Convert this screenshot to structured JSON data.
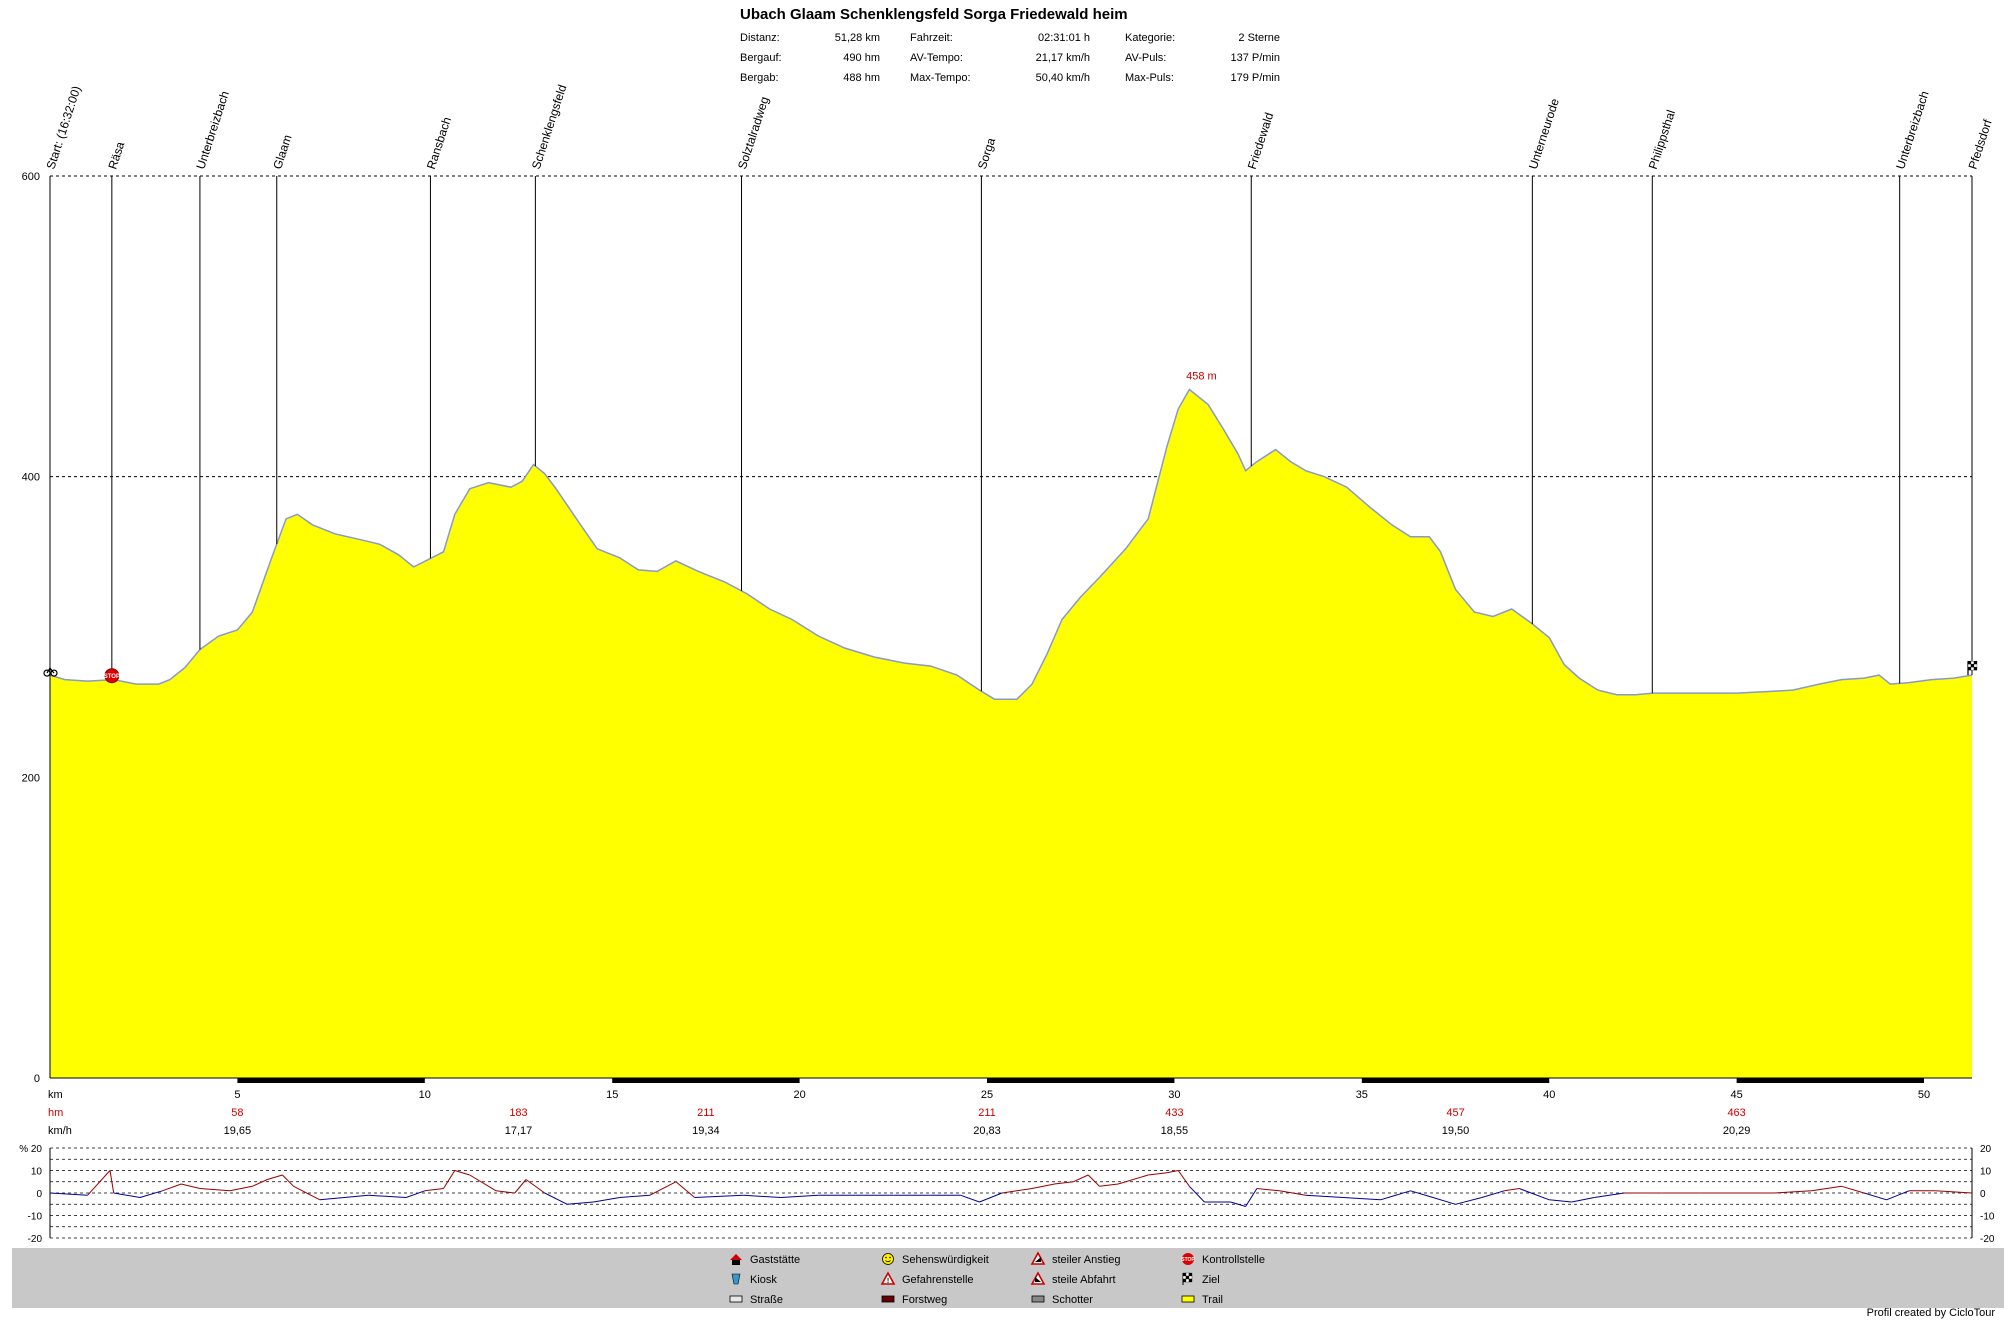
{
  "title": "Ubach Glaam Schenklengsfeld Sorga Friedewald heim",
  "stats": {
    "col1": [
      {
        "label": "Distanz:",
        "value": "51,28 km"
      },
      {
        "label": "Bergauf:",
        "value": "490 hm"
      },
      {
        "label": "Bergab:",
        "value": "488 hm"
      }
    ],
    "col2": [
      {
        "label": "Fahrzeit:",
        "value": "02:31:01 h"
      },
      {
        "label": "AV-Tempo:",
        "value": "21,17 km/h"
      },
      {
        "label": "Max-Tempo:",
        "value": "50,40 km/h"
      }
    ],
    "col3": [
      {
        "label": "Kategorie:",
        "value": "2 Sterne"
      },
      {
        "label": "AV-Puls:",
        "value": "137 P/min"
      },
      {
        "label": "Max-Puls:",
        "value": "179 P/min"
      }
    ]
  },
  "colors": {
    "fill": "#ffff00",
    "profile_line": "#8899cc",
    "grade_up": "#990000",
    "grade_down": "#000099",
    "accent_red": "#cc0000",
    "legend_bg": "#c8c8c8"
  },
  "chart_data": [
    {
      "type": "area",
      "x_unit": "km",
      "y_unit": "m",
      "xlim": [
        0,
        51.28
      ],
      "ylim": [
        0,
        600
      ],
      "y_ticks": [
        0,
        200,
        400,
        600
      ],
      "x_ticks": [
        5,
        10,
        15,
        20,
        25,
        30,
        35,
        40,
        45,
        50
      ],
      "grid": "horizontal dashed",
      "x_axis_label": "km",
      "max_label": "458 m",
      "max_point": {
        "x": 30.4,
        "y": 458
      },
      "waypoints": [
        {
          "name": "Start: (16:32:00)",
          "km": 0.0
        },
        {
          "name": "Räsa",
          "km": 1.65
        },
        {
          "name": "Unterbreizbach",
          "km": 4.0
        },
        {
          "name": "Glaam",
          "km": 6.05
        },
        {
          "name": "Ransbach",
          "km": 10.15
        },
        {
          "name": "Schenklengsfeld",
          "km": 12.95
        },
        {
          "name": "Solztalradweg",
          "km": 18.45
        },
        {
          "name": "Sorga",
          "km": 24.85
        },
        {
          "name": "Friedewald",
          "km": 32.05
        },
        {
          "name": "Unterneurode",
          "km": 39.55
        },
        {
          "name": "Philippsthal",
          "km": 42.75
        },
        {
          "name": "Unterbreizbach",
          "km": 49.35
        },
        {
          "name": "Pfedsdorf",
          "km": 51.28
        }
      ],
      "series": [
        {
          "points": [
            [
              0.0,
              268
            ],
            [
              0.4,
              265
            ],
            [
              1.0,
              264
            ],
            [
              1.7,
              265
            ],
            [
              2.3,
              262
            ],
            [
              2.9,
              262
            ],
            [
              3.2,
              265
            ],
            [
              3.6,
              273
            ],
            [
              4.0,
              285
            ],
            [
              4.5,
              294
            ],
            [
              5.0,
              298
            ],
            [
              5.4,
              310
            ],
            [
              5.9,
              345
            ],
            [
              6.3,
              372
            ],
            [
              6.6,
              375
            ],
            [
              7.0,
              368
            ],
            [
              7.6,
              362
            ],
            [
              8.3,
              358
            ],
            [
              8.8,
              355
            ],
            [
              9.3,
              348
            ],
            [
              9.7,
              340
            ],
            [
              10.1,
              345
            ],
            [
              10.5,
              350
            ],
            [
              10.8,
              375
            ],
            [
              11.2,
              392
            ],
            [
              11.7,
              396
            ],
            [
              12.3,
              393
            ],
            [
              12.6,
              397
            ],
            [
              12.9,
              408
            ],
            [
              13.2,
              402
            ],
            [
              13.5,
              392
            ],
            [
              14.1,
              370
            ],
            [
              14.6,
              352
            ],
            [
              15.2,
              346
            ],
            [
              15.7,
              338
            ],
            [
              16.2,
              337
            ],
            [
              16.7,
              344
            ],
            [
              17.3,
              337
            ],
            [
              18.0,
              330
            ],
            [
              18.6,
              322
            ],
            [
              19.2,
              312
            ],
            [
              19.8,
              305
            ],
            [
              20.5,
              294
            ],
            [
              21.2,
              286
            ],
            [
              22.0,
              280
            ],
            [
              22.8,
              276
            ],
            [
              23.5,
              274
            ],
            [
              24.2,
              268
            ],
            [
              24.8,
              258
            ],
            [
              25.2,
              252
            ],
            [
              25.8,
              252
            ],
            [
              26.2,
              262
            ],
            [
              26.6,
              282
            ],
            [
              27.0,
              305
            ],
            [
              27.5,
              320
            ],
            [
              28.0,
              333
            ],
            [
              28.7,
              352
            ],
            [
              29.3,
              372
            ],
            [
              29.8,
              420
            ],
            [
              30.1,
              445
            ],
            [
              30.4,
              458
            ],
            [
              30.9,
              448
            ],
            [
              31.3,
              432
            ],
            [
              31.7,
              415
            ],
            [
              31.9,
              404
            ],
            [
              32.2,
              410
            ],
            [
              32.7,
              418
            ],
            [
              33.1,
              410
            ],
            [
              33.5,
              404
            ],
            [
              34.0,
              400
            ],
            [
              34.6,
              393
            ],
            [
              35.2,
              380
            ],
            [
              35.8,
              368
            ],
            [
              36.3,
              360
            ],
            [
              36.8,
              360
            ],
            [
              37.1,
              350
            ],
            [
              37.5,
              325
            ],
            [
              38.0,
              310
            ],
            [
              38.5,
              307
            ],
            [
              39.0,
              312
            ],
            [
              39.5,
              303
            ],
            [
              40.0,
              293
            ],
            [
              40.4,
              275
            ],
            [
              40.8,
              266
            ],
            [
              41.3,
              258
            ],
            [
              41.8,
              255
            ],
            [
              42.3,
              255
            ],
            [
              42.8,
              256
            ],
            [
              43.5,
              256
            ],
            [
              44.2,
              256
            ],
            [
              45.0,
              256
            ],
            [
              45.8,
              257
            ],
            [
              46.5,
              258
            ],
            [
              47.2,
              262
            ],
            [
              47.8,
              265
            ],
            [
              48.4,
              266
            ],
            [
              48.8,
              268
            ],
            [
              49.1,
              262
            ],
            [
              49.6,
              263
            ],
            [
              50.2,
              265
            ],
            [
              50.8,
              266
            ],
            [
              51.28,
              268
            ]
          ]
        }
      ],
      "markers": [
        {
          "kind": "start",
          "km": 0.0,
          "label": "Start"
        },
        {
          "kind": "stop",
          "km": 1.65,
          "label": "STOP"
        },
        {
          "kind": "finish",
          "km": 51.28,
          "label": "Ziel"
        }
      ]
    },
    {
      "type": "table",
      "rows": [
        {
          "label": "hm",
          "values": [
            "58",
            "183",
            "211",
            "211",
            "433",
            "457",
            "463"
          ]
        },
        {
          "label": "km/h",
          "values": [
            "19,65",
            "17,17",
            "19,34",
            "20,83",
            "18,55",
            "19,50",
            "20,29"
          ]
        }
      ],
      "at_km": [
        5,
        12.5,
        17.5,
        25,
        30,
        37.5,
        45
      ]
    },
    {
      "type": "line",
      "y_unit": "%",
      "ylim": [
        -20,
        20
      ],
      "y_ticks": [
        -20,
        -10,
        0,
        10,
        20
      ],
      "axis_label": "%",
      "grid": "horizontal dashed",
      "series": [
        {
          "points": [
            [
              0.0,
              0
            ],
            [
              1.0,
              -1
            ],
            [
              1.6,
              10
            ],
            [
              1.7,
              0
            ],
            [
              2.4,
              -2
            ],
            [
              3.0,
              1
            ],
            [
              3.5,
              4
            ],
            [
              4.0,
              2
            ],
            [
              4.8,
              1
            ],
            [
              5.4,
              3
            ],
            [
              5.8,
              6
            ],
            [
              6.2,
              8
            ],
            [
              6.5,
              3
            ],
            [
              7.2,
              -3
            ],
            [
              8.5,
              -1
            ],
            [
              9.5,
              -2
            ],
            [
              10.0,
              1
            ],
            [
              10.5,
              2
            ],
            [
              10.8,
              10
            ],
            [
              11.2,
              8
            ],
            [
              11.9,
              1
            ],
            [
              12.4,
              0
            ],
            [
              12.7,
              6
            ],
            [
              13.2,
              0
            ],
            [
              13.8,
              -5
            ],
            [
              14.5,
              -4
            ],
            [
              15.2,
              -2
            ],
            [
              16.0,
              -1
            ],
            [
              16.7,
              5
            ],
            [
              17.2,
              -2
            ],
            [
              18.5,
              -1
            ],
            [
              19.5,
              -2
            ],
            [
              20.5,
              -1
            ],
            [
              21.5,
              -1
            ],
            [
              22.5,
              -1
            ],
            [
              23.5,
              -1
            ],
            [
              24.3,
              -1
            ],
            [
              24.8,
              -4
            ],
            [
              25.4,
              0
            ],
            [
              26.2,
              2
            ],
            [
              26.8,
              4
            ],
            [
              27.3,
              5
            ],
            [
              27.7,
              8
            ],
            [
              28.0,
              3
            ],
            [
              28.5,
              4
            ],
            [
              29.3,
              8
            ],
            [
              29.8,
              9
            ],
            [
              30.1,
              10
            ],
            [
              30.4,
              3
            ],
            [
              30.8,
              -4
            ],
            [
              31.5,
              -4
            ],
            [
              31.9,
              -6
            ],
            [
              32.2,
              2
            ],
            [
              32.8,
              1
            ],
            [
              33.5,
              -1
            ],
            [
              34.5,
              -2
            ],
            [
              35.5,
              -3
            ],
            [
              36.3,
              1
            ],
            [
              36.9,
              -2
            ],
            [
              37.5,
              -5
            ],
            [
              38.2,
              -2
            ],
            [
              38.8,
              1
            ],
            [
              39.2,
              2
            ],
            [
              40.0,
              -3
            ],
            [
              40.6,
              -4
            ],
            [
              41.2,
              -2
            ],
            [
              42.0,
              0
            ],
            [
              43.0,
              0
            ],
            [
              44.0,
              0
            ],
            [
              45.0,
              0
            ],
            [
              46.0,
              0
            ],
            [
              47.0,
              1
            ],
            [
              47.8,
              3
            ],
            [
              48.4,
              0
            ],
            [
              49.0,
              -3
            ],
            [
              49.6,
              1
            ],
            [
              50.3,
              1
            ],
            [
              51.28,
              0
            ]
          ]
        }
      ]
    }
  ],
  "legend": {
    "items": [
      {
        "label": "Gaststätte",
        "icon": "house-icon"
      },
      {
        "label": "Kiosk",
        "icon": "kiosk-icon"
      },
      {
        "label": "Straße",
        "icon": "road-surface-icon"
      },
      {
        "label": "Sehenswürdigkeit",
        "icon": "smiley-icon"
      },
      {
        "label": "Gefahrenstelle",
        "icon": "danger-sign-icon"
      },
      {
        "label": "Forstweg",
        "icon": "forest-track-surface-icon"
      },
      {
        "label": "steiler Anstieg",
        "icon": "steep-climb-sign-icon"
      },
      {
        "label": "steile Abfahrt",
        "icon": "steep-descent-sign-icon"
      },
      {
        "label": "Schotter",
        "icon": "gravel-surface-icon"
      },
      {
        "label": "Kontrollstelle",
        "icon": "stop-sign-icon"
      },
      {
        "label": "Ziel",
        "icon": "checkered-flag-icon"
      },
      {
        "label": "Trail",
        "icon": "trail-surface-icon"
      }
    ]
  },
  "footer": "Profil created by CicloTour"
}
